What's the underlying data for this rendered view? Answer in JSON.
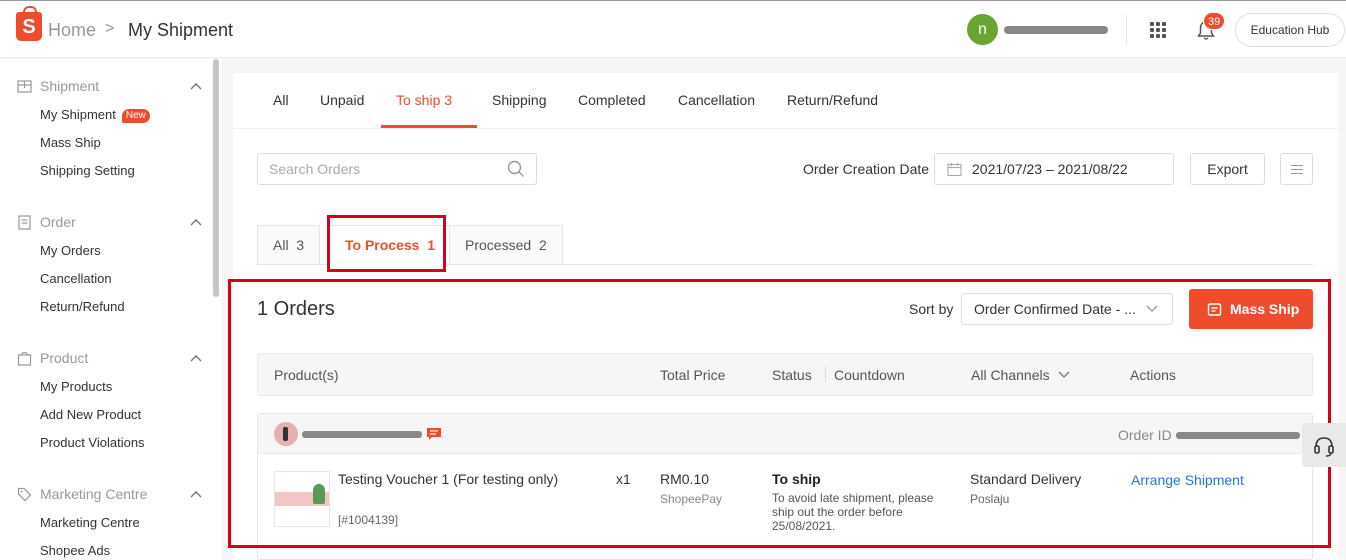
{
  "header": {
    "breadcrumb_home": "Home",
    "breadcrumb_sep": ">",
    "breadcrumb_current": "My Shipment",
    "avatar_letter": "n",
    "notification_count": "39",
    "education_hub": "Education Hub",
    "logo_letter": "S"
  },
  "sidebar": {
    "sections": [
      {
        "title": "Shipment",
        "items": [
          {
            "label": "My Shipment",
            "badge": "New"
          },
          {
            "label": "Mass Ship"
          },
          {
            "label": "Shipping Setting"
          }
        ]
      },
      {
        "title": "Order",
        "items": [
          {
            "label": "My Orders"
          },
          {
            "label": "Cancellation"
          },
          {
            "label": "Return/Refund"
          }
        ]
      },
      {
        "title": "Product",
        "items": [
          {
            "label": "My Products"
          },
          {
            "label": "Add New Product"
          },
          {
            "label": "Product Violations"
          }
        ]
      },
      {
        "title": "Marketing Centre",
        "items": [
          {
            "label": "Marketing Centre"
          },
          {
            "label": "Shopee Ads"
          }
        ]
      }
    ]
  },
  "tabs": [
    {
      "label": "All"
    },
    {
      "label": "Unpaid"
    },
    {
      "label": "To ship 3",
      "active": true
    },
    {
      "label": "Shipping"
    },
    {
      "label": "Completed"
    },
    {
      "label": "Cancellation"
    },
    {
      "label": "Return/Refund"
    }
  ],
  "filters": {
    "search_placeholder": "Search Orders",
    "date_label": "Order Creation Date",
    "date_range": "2021/07/23 – 2021/08/22",
    "export_label": "Export"
  },
  "subtabs": [
    {
      "label": "All",
      "count": "3"
    },
    {
      "label": "To Process",
      "count": "1",
      "active": true
    },
    {
      "label": "Processed",
      "count": "2"
    }
  ],
  "orders_section": {
    "count_label": "1 Orders",
    "sort_label": "Sort by",
    "sort_value": "Order Confirmed Date - ...",
    "mass_ship_label": "Mass Ship"
  },
  "table": {
    "headers": {
      "products": "Product(s)",
      "total_price": "Total Price",
      "status": "Status",
      "countdown": "Countdown",
      "channels": "All Channels",
      "actions": "Actions"
    }
  },
  "order": {
    "order_id_label": "Order ID",
    "product_name": "Testing Voucher 1 (For testing only)",
    "sku": "[#1004139]",
    "quantity": "x1",
    "price": "RM0.10",
    "payment": "ShopeePay",
    "status": "To ship",
    "status_note": "To avoid late shipment, please ship out the order before 25/08/2021.",
    "channel": "Standard Delivery",
    "courier": "Poslaju",
    "action": "Arrange Shipment"
  },
  "colors": {
    "brand": "#ee4d2d",
    "link": "#2673dd",
    "highlight_box": "#d9001b"
  }
}
